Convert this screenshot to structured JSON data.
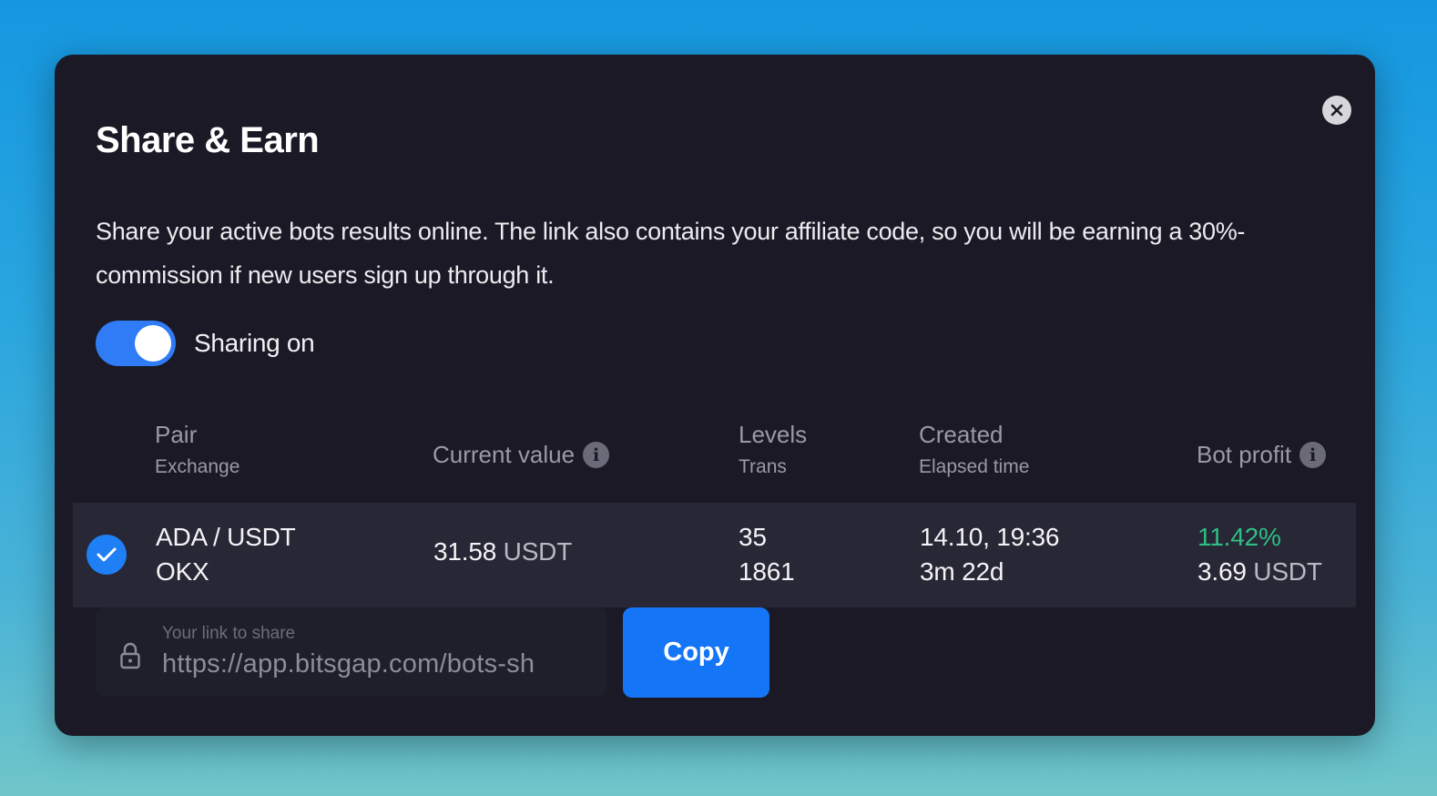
{
  "modal": {
    "title": "Share & Earn",
    "description": "Share your active bots results online. The link also contains your affiliate code, so you will be earning a 30%-commission if new users sign up through it.",
    "toggle": {
      "label": "Sharing on",
      "on": true
    }
  },
  "table": {
    "headers": {
      "pair": "Pair",
      "exchange": "Exchange",
      "current_value": "Current value",
      "levels": "Levels",
      "trans": "Trans",
      "created": "Created",
      "elapsed": "Elapsed time",
      "bot_profit": "Bot profit"
    },
    "rows": [
      {
        "selected": true,
        "pair": "ADA / USDT",
        "exchange": "OKX",
        "current_value": "31.58",
        "current_value_unit": "USDT",
        "levels": "35",
        "trans": "1861",
        "created": "14.10, 19:36",
        "elapsed": "3m 22d",
        "profit_percent": "11.42%",
        "profit_value": "3.69",
        "profit_unit": "USDT"
      }
    ]
  },
  "share": {
    "label": "Your link to share",
    "url": "https://app.bitsgap.com/bots-sh",
    "copy_label": "Copy"
  },
  "colors": {
    "accent": "#1476f7",
    "profit_green": "#2fbf85",
    "modal_bg": "#1a1925"
  }
}
